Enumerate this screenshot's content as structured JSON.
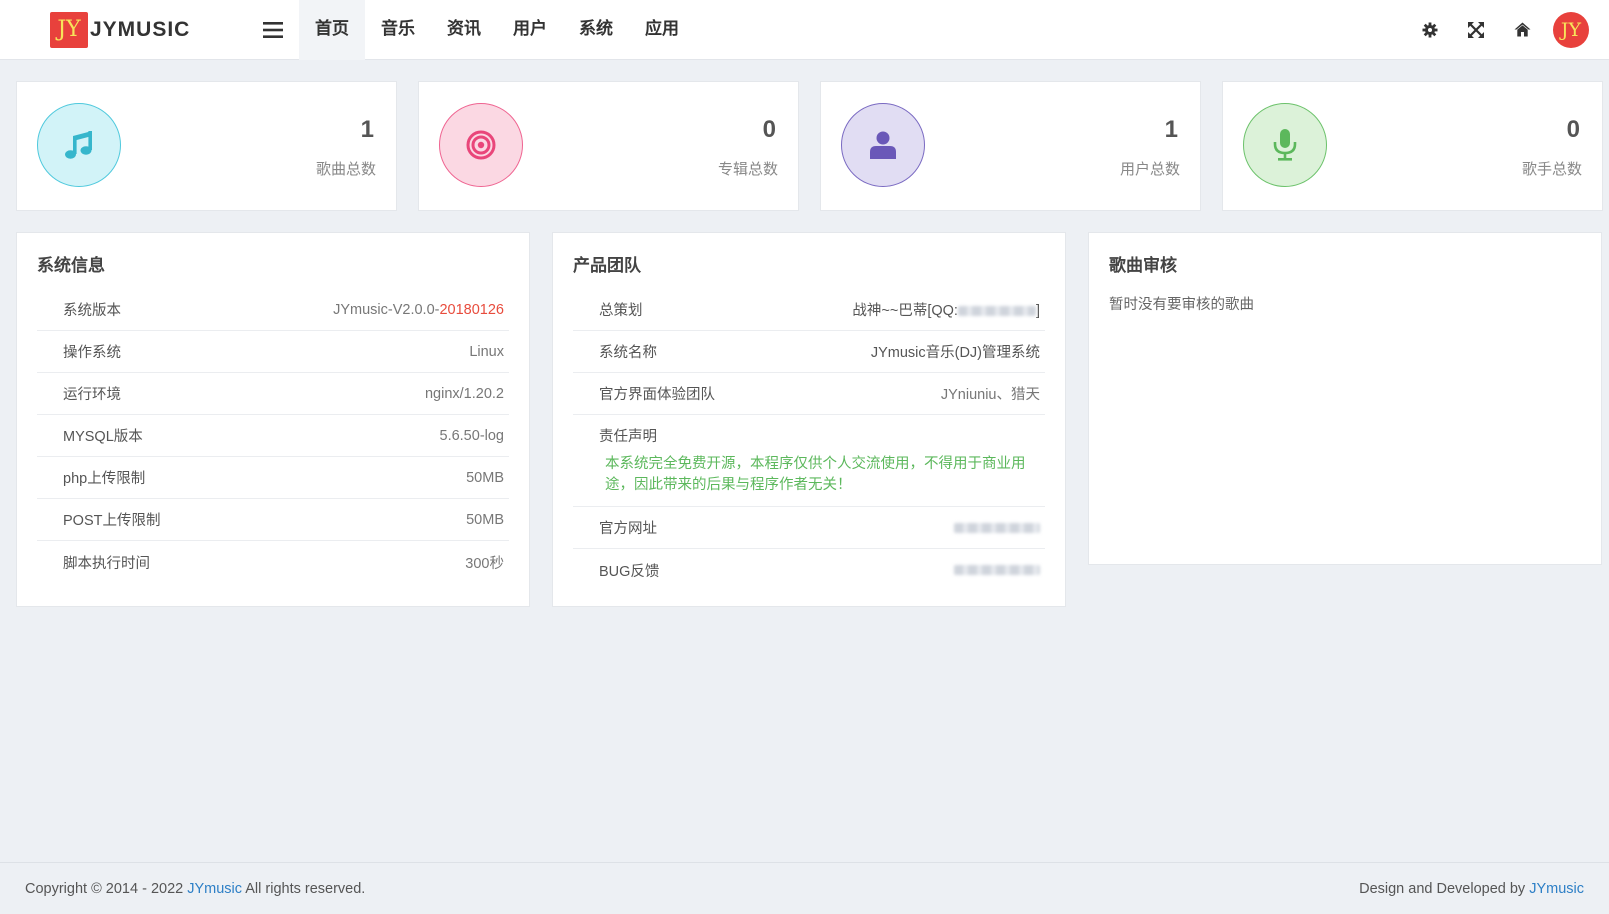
{
  "brand": {
    "logo_text": "JY",
    "name": "JYMUSIC"
  },
  "nav": [
    {
      "label": "首页",
      "active": true
    },
    {
      "label": "音乐"
    },
    {
      "label": "资讯"
    },
    {
      "label": "用户"
    },
    {
      "label": "系统"
    },
    {
      "label": "应用"
    }
  ],
  "tools": [
    "gear-icon",
    "fullscreen-icon",
    "home-icon"
  ],
  "avatar": {
    "text": "JY"
  },
  "stats": [
    {
      "value": "1",
      "label": "歌曲总数",
      "icon": "music-note-icon",
      "color": "#4fc9dd"
    },
    {
      "value": "0",
      "label": "专辑总数",
      "icon": "target-icon",
      "color": "#ef6491"
    },
    {
      "value": "1",
      "label": "用户总数",
      "icon": "user-icon",
      "color": "#7a6ac2"
    },
    {
      "value": "0",
      "label": "歌手总数",
      "icon": "microphone-icon",
      "color": "#6cc26b"
    }
  ],
  "sysinfo": {
    "title": "系统信息",
    "rows": [
      {
        "key": "系统版本",
        "value_prefix": "JYmusic-V2.0.0-",
        "value_suffix": "20180126"
      },
      {
        "key": "操作系统",
        "value": "Linux"
      },
      {
        "key": "运行环境",
        "value": "nginx/1.20.2"
      },
      {
        "key": "MYSQL版本",
        "value": "5.6.50-log"
      },
      {
        "key": "php上传限制",
        "value": "50MB"
      },
      {
        "key": "POST上传限制",
        "value": "50MB"
      },
      {
        "key": "脚本执行时间",
        "value": "300秒"
      }
    ]
  },
  "team": {
    "title": "产品团队",
    "planner_key": "总策划",
    "planner_value_prefix": "战神~~巴蒂[QQ:",
    "planner_value_suffix": "]",
    "sysname_key": "系统名称",
    "sysname_value": "JYmusic音乐(DJ)管理系统",
    "ui_key": "官方界面体验团队",
    "ui_value": "JYniuniu、猎天",
    "statement_key": "责任声明",
    "statement_text": "本系统完全免费开源，本程序仅供个人交流使用，不得用于商业用途，因此带来的后果与程序作者无关！",
    "site_key": "官方网址",
    "bug_key": "BUG反馈"
  },
  "review": {
    "title": "歌曲审核",
    "empty_text": "暂时没有要审核的歌曲"
  },
  "footer": {
    "copyright_prefix": "Copyright © 2014 - 2022 ",
    "copyright_link": "JYmusic",
    "copyright_suffix": " All rights reserved.",
    "design_prefix": "Design and Developed by ",
    "design_link": "JYmusic"
  }
}
